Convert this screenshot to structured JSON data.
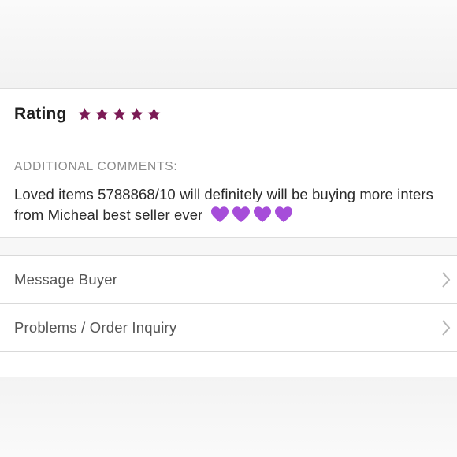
{
  "review": {
    "rating_label": "Rating",
    "rating_value": 5,
    "rating_max": 5,
    "star_color": "#7b1a55",
    "comments_heading": "ADDITIONAL COMMENTS:",
    "comment_text": "Loved items 5788868/10 will definitely will be buying more inters from Micheal best seller ever",
    "comment_emoji": "💜💜💜💜",
    "heart_color": "#a64dd9"
  },
  "actions": {
    "message_buyer_label": "Message Buyer",
    "order_inquiry_label": "Problems / Order Inquiry",
    "chevron_icon": "chevron-right-icon"
  }
}
